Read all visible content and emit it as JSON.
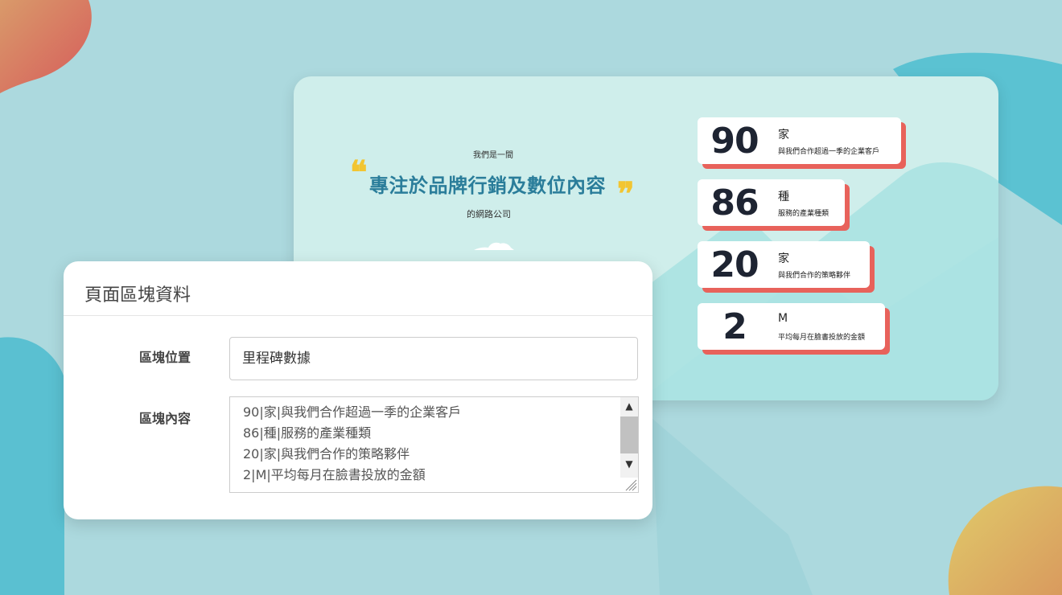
{
  "preview": {
    "intro": "我們是一間",
    "headline": "專注於品牌行銷及數位內容",
    "tail": "的網路公司",
    "quote_open": "❝",
    "quote_close": "❞",
    "stats": [
      {
        "number": "90",
        "unit": "家",
        "desc": "與我們合作超過一季的企業客戶"
      },
      {
        "number": "86",
        "unit": "種",
        "desc": "服務的產業種類"
      },
      {
        "number": "20",
        "unit": "家",
        "desc": "與我們合作的策略夥伴"
      },
      {
        "number": "2",
        "unit": "M",
        "desc": "平均每月在臉書投放的金額"
      }
    ]
  },
  "form": {
    "title": "頁面區塊資料",
    "position_label": "區塊位置",
    "position_value": "里程碑數據",
    "content_label": "區塊內容",
    "content_lines": [
      "90|家|與我們合作超過一季的企業客戶",
      "86|種|服務的產業種類",
      "20|家|與我們合作的策略夥伴",
      "2|M|平均每月在臉書投放的金額"
    ]
  },
  "colors": {
    "background": "#acd9de",
    "card": "#cfeeeb",
    "headline": "#2a7d9a",
    "quote": "#f2c531",
    "stat_shadow": "#e8625b",
    "stat_number": "#1e2432"
  },
  "icons": [
    "quote-open-icon",
    "quote-close-icon",
    "cloud-icon",
    "scroll-up-icon",
    "scroll-down-icon",
    "resize-handle-icon"
  ]
}
